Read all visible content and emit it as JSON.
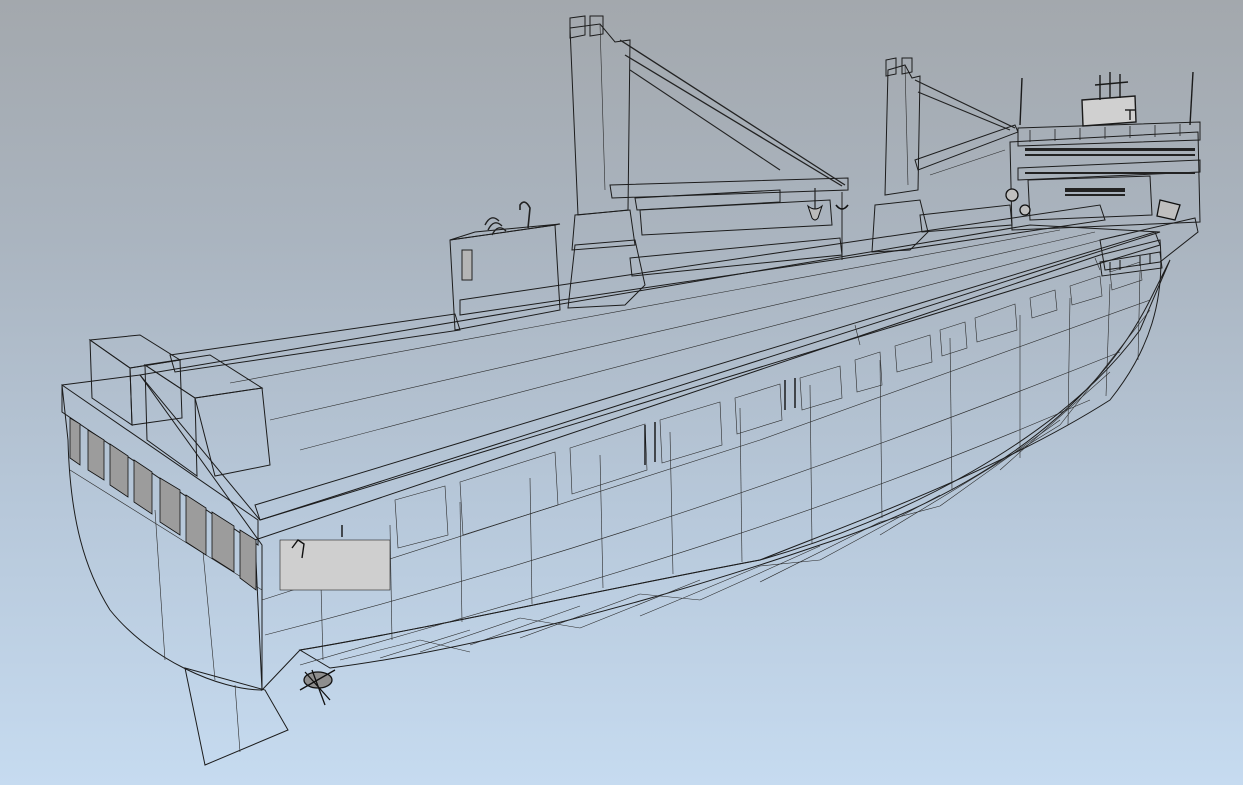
{
  "viewport": {
    "background_top": "#a3a8ad",
    "background_bottom": "#c6dbf0",
    "model": "cargo-ship-3d-model",
    "render_style": "shaded-with-edges",
    "surface_color": "#d9d9d9",
    "edge_color": "#1c1c1c"
  }
}
